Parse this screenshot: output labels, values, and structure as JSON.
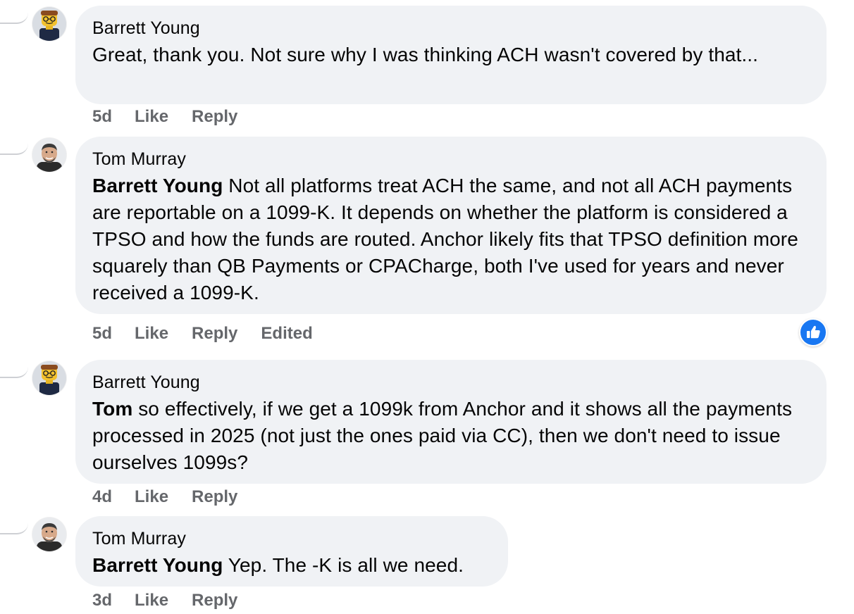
{
  "comments": [
    {
      "author": "Barrett Young",
      "mention": "",
      "text": "Great, thank you. Not sure why I was thinking ACH wasn't covered by that...",
      "time": "5d",
      "like": "Like",
      "reply": "Reply",
      "edited": ""
    },
    {
      "author": "Tom Murray",
      "mention": "Barrett Young",
      "text": " Not all platforms treat ACH the same, and not all ACH payments are reportable on a 1099-K. It depends on whether the platform is considered a TPSO and how the funds are routed. Anchor likely fits that TPSO definition more squarely than QB Payments or CPACharge, both I've used for years and never received a 1099-K.",
      "time": "5d",
      "like": "Like",
      "reply": "Reply",
      "edited": "Edited"
    },
    {
      "author": "Barrett Young",
      "mention": "Tom",
      "text": " so effectively, if we get a 1099k from Anchor and it shows all the payments processed in 2025 (not just the ones paid via CC), then we don't need to issue ourselves 1099s?",
      "time": "4d",
      "like": "Like",
      "reply": "Reply",
      "edited": ""
    },
    {
      "author": "Tom Murray",
      "mention": "Barrett Young",
      "text": " Yep. The -K is all we need.",
      "time": "3d",
      "like": "Like",
      "reply": "Reply",
      "edited": ""
    }
  ],
  "reaction": {
    "icon": "thumbs-up-icon",
    "color": "#1877f2"
  }
}
